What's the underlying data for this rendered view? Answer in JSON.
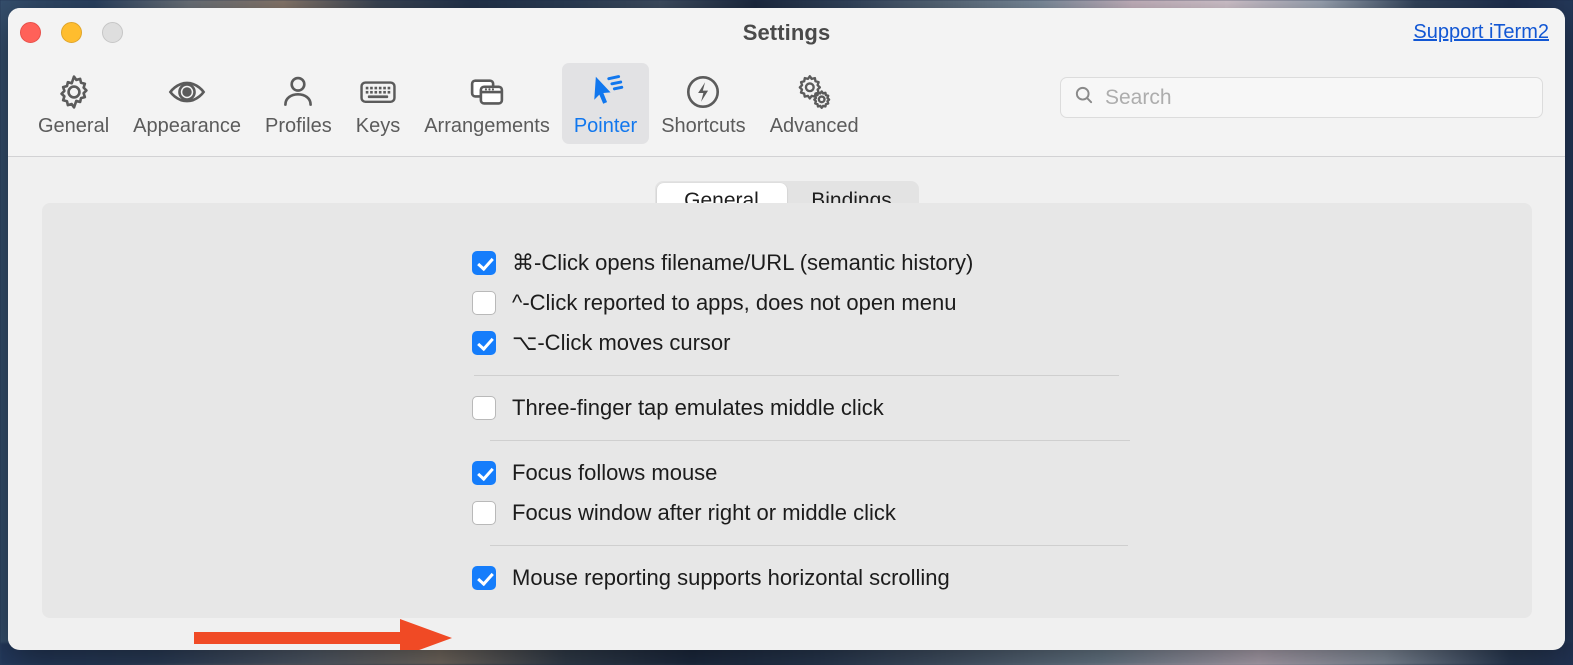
{
  "window": {
    "title": "Settings",
    "support_link": "Support iTerm2",
    "traffic_lights": [
      "close-red",
      "minimize-yellow",
      "zoom-gray"
    ]
  },
  "toolbar": {
    "items": [
      {
        "label": "General",
        "icon": "gear-icon",
        "selected": false
      },
      {
        "label": "Appearance",
        "icon": "eye-icon",
        "selected": false
      },
      {
        "label": "Profiles",
        "icon": "person-icon",
        "selected": false
      },
      {
        "label": "Keys",
        "icon": "keyboard-icon",
        "selected": false
      },
      {
        "label": "Arrangements",
        "icon": "windows-icon",
        "selected": false
      },
      {
        "label": "Pointer",
        "icon": "cursor-arrow-icon",
        "selected": true
      },
      {
        "label": "Shortcuts",
        "icon": "bolt-circle-icon",
        "selected": false
      },
      {
        "label": "Advanced",
        "icon": "double-gear-icon",
        "selected": false
      }
    ],
    "search": {
      "placeholder": "Search",
      "value": "",
      "icon": "search-icon"
    }
  },
  "content": {
    "segmented_control": {
      "options": [
        "General",
        "Bindings"
      ],
      "selected": "General"
    },
    "groups": [
      {
        "rows": [
          {
            "label": "⌘-Click opens filename/URL (semantic history)",
            "checked": true
          },
          {
            "label": "^-Click reported to apps, does not open menu",
            "checked": false
          },
          {
            "label": "⌥-Click moves cursor",
            "checked": true
          }
        ]
      },
      {
        "rows": [
          {
            "label": "Three-finger tap emulates middle click",
            "checked": false
          }
        ]
      },
      {
        "rows": [
          {
            "label": "Focus follows mouse",
            "checked": true
          },
          {
            "label": "Focus window after right or middle click",
            "checked": false
          }
        ]
      },
      {
        "rows": [
          {
            "label": "Mouse reporting supports horizontal scrolling",
            "checked": true
          }
        ]
      }
    ]
  },
  "annotation": {
    "arrow": {
      "name": "red-arrow-pointing-to-focus-follows-mouse",
      "color": "#f04a25",
      "direction": "right",
      "points_to": "Focus follows mouse"
    }
  },
  "colors": {
    "accent_blue": "#157dfb",
    "link_blue": "#1257d4",
    "window_bg": "#f0f0f0",
    "panel_bg": "#e7e7e7",
    "toolbar_bg": "#f3f3f3"
  }
}
